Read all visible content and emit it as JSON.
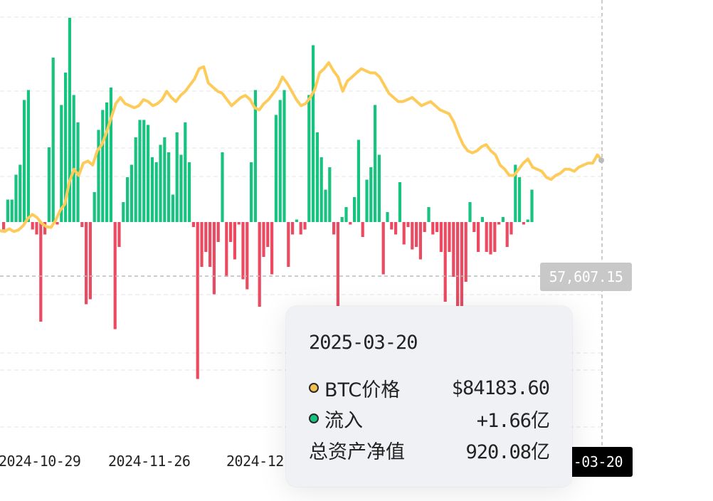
{
  "colors": {
    "inflow": "#18c27f",
    "outflow": "#ec4a61",
    "price_line": "#fdcb5a",
    "grid": "#e6e6e6"
  },
  "chart_data": {
    "type": "bar",
    "series": [
      {
        "name": "流入",
        "type": "bar",
        "values": [
          -0.3,
          0.9,
          0.9,
          1.9,
          2.3,
          4.9,
          5.3,
          -0.3,
          -0.5,
          -4.0,
          -0.5,
          3.0,
          6.6,
          -0.1,
          4.7,
          6.0,
          8.2,
          5.1,
          4.0,
          -0.2,
          -3.3,
          -3.1,
          1.2,
          3.7,
          4.5,
          4.8,
          5.4,
          -4.3,
          -1.0,
          0.8,
          1.8,
          2.3,
          3.4,
          4.1,
          4.1,
          3.9,
          2.6,
          2.4,
          3.1,
          3.4,
          2.8,
          1.1,
          3.6,
          2.7,
          4.0,
          2.4,
          -0.2,
          -6.3,
          -1.8,
          -1.2,
          -1.8,
          -2.9,
          -0.8,
          2.8,
          -2.2,
          -0.8,
          -1.5,
          -0.1,
          -2.3,
          -2.7,
          2.4,
          5.3,
          -3.4,
          -1.4,
          -1.0,
          -2.1,
          4.3,
          4.9,
          5.3,
          -1.8,
          -0.5,
          0.1,
          -0.5,
          -0.3,
          5.1,
          7.1,
          3.6,
          2.6,
          1.3,
          2.2,
          -0.5,
          -3.4,
          0.2,
          0.6,
          -0.1,
          1.0,
          3.3,
          -0.6,
          1.7,
          2.2,
          4.7,
          2.7,
          -2.1,
          0.4,
          -0.3,
          -0.5,
          1.6,
          -0.9,
          -0.2,
          -1.1,
          -1.0,
          -1.5,
          -0.4,
          0.6,
          -0.5,
          -0.4,
          -1.2,
          -3.2,
          -1.2,
          -2.2,
          -4.0,
          -4.0,
          -2.4,
          0.8,
          -0.4,
          -1.2,
          0.2,
          -1.2,
          -1.3,
          -1.2,
          -0.1,
          0.2,
          -1.0,
          -0.5,
          2.3,
          1.8,
          -0.1,
          0.1,
          1.3
        ],
        "unit": "亿"
      },
      {
        "name": "BTC价格",
        "type": "line",
        "unit": "$",
        "values": [
          67000,
          66800,
          67500,
          66800,
          67200,
          68200,
          70000,
          71000,
          70200,
          68800,
          68000,
          67800,
          69500,
          72000,
          73500,
          79000,
          82000,
          80500,
          83500,
          84000,
          83000,
          86500,
          88000,
          91000,
          94500,
          98000,
          99500,
          98000,
          97500,
          97000,
          97500,
          99000,
          98500,
          97500,
          98000,
          99000,
          101000,
          99500,
          98500,
          100000,
          101000,
          102500,
          104000,
          106500,
          107000,
          103000,
          102000,
          101000,
          100500,
          99000,
          97500,
          98500,
          99500,
          100000,
          99000,
          97000,
          96500,
          98000,
          99000,
          100500,
          102000,
          104500,
          103000,
          101000,
          99000,
          97500,
          98000,
          99500,
          101500,
          105500,
          106500,
          108000,
          106000,
          104500,
          101000,
          103500,
          104500,
          105500,
          106500,
          106000,
          105500,
          105500,
          104500,
          102500,
          100500,
          99500,
          98500,
          98500,
          99000,
          99500,
          98500,
          97500,
          98000,
          98500,
          97500,
          96500,
          96000,
          95500,
          93500,
          90500,
          88000,
          86500,
          86000,
          86500,
          87500,
          88000,
          86500,
          85500,
          83000,
          82000,
          80500,
          80500,
          82000,
          83500,
          84500,
          82500,
          82000,
          81500,
          80000,
          79500,
          80500,
          81000,
          82000,
          82000,
          81500,
          82500,
          83000,
          83500,
          83500,
          85500,
          84183.6
        ]
      }
    ],
    "x_ticks": [
      "2024-10-29",
      "2024-11-26",
      "2024-12"
    ],
    "crosshair": {
      "y_value": "57,607.15",
      "x_value": "-03-20"
    }
  },
  "tooltip": {
    "date": "2025-03-20",
    "btc_label": "BTC价格",
    "btc_value": "$84183.60",
    "inflow_label": "流入",
    "inflow_value": "+1.66亿",
    "nav_label": "总资产净值",
    "nav_value": "920.08亿"
  }
}
